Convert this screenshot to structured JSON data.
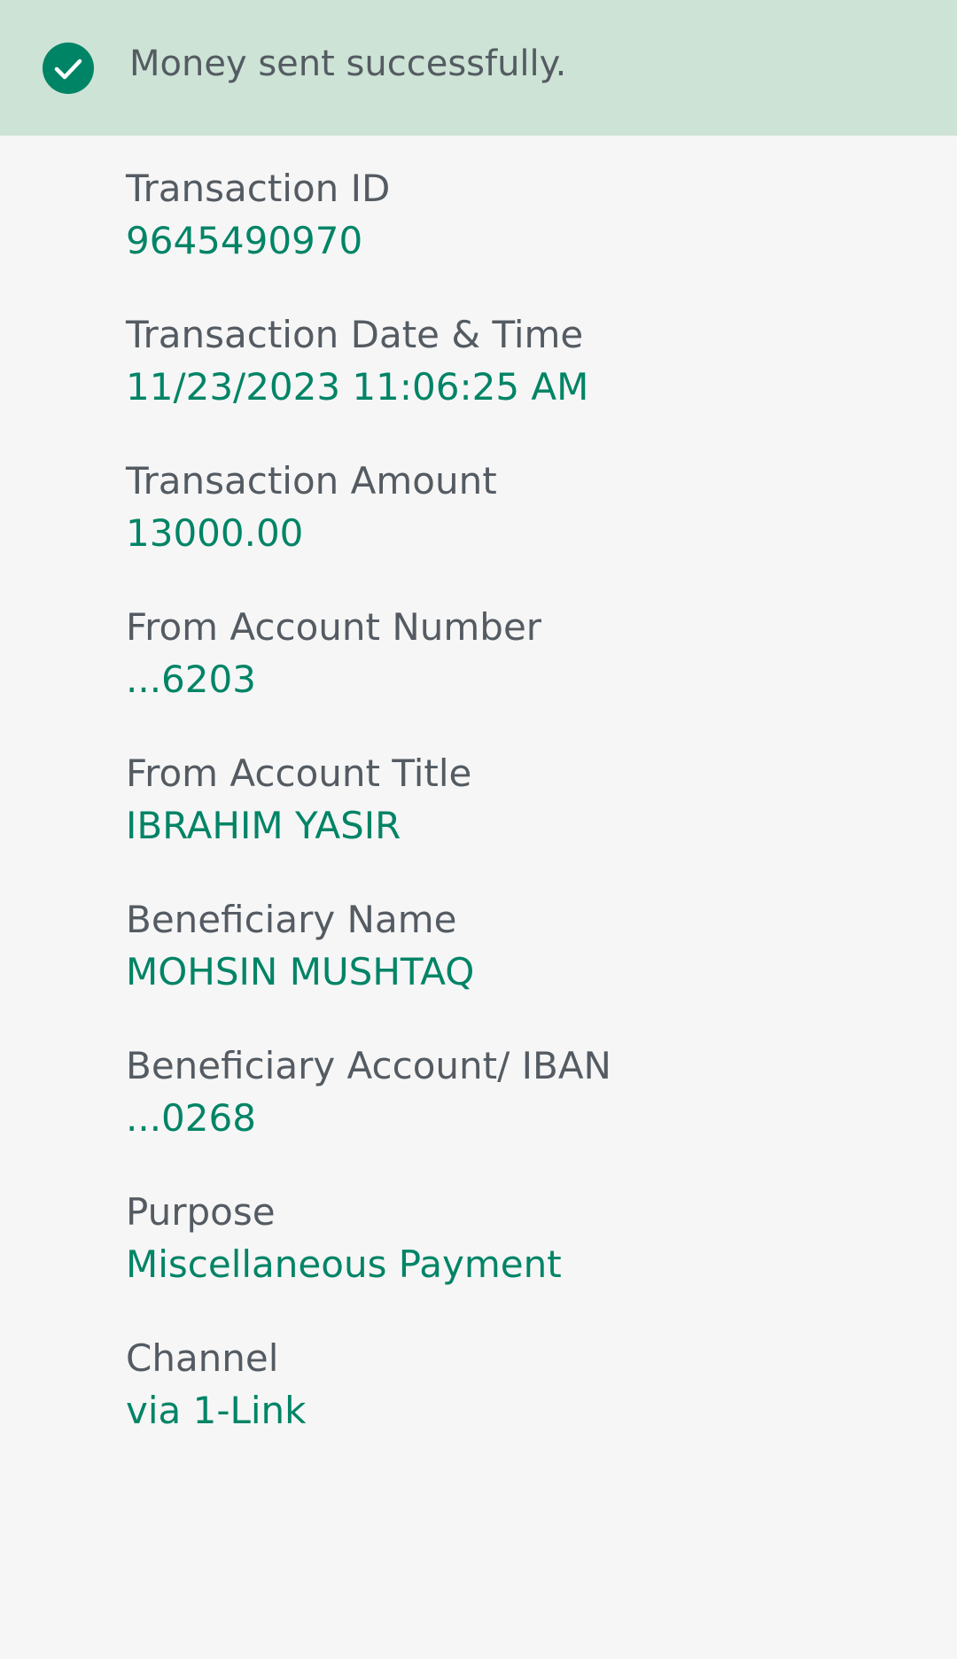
{
  "banner": {
    "icon": "check-circle-icon",
    "message": "Money sent successfully."
  },
  "details": [
    {
      "label": "Transaction ID",
      "value": "9645490970"
    },
    {
      "label": "Transaction Date & Time",
      "value": "11/23/2023 11:06:25 AM"
    },
    {
      "label": "Transaction Amount",
      "value": "13000.00"
    },
    {
      "label": "From Account Number",
      "value": "...6203"
    },
    {
      "label": "From Account Title",
      "value": "IBRAHIM YASIR"
    },
    {
      "label": "Beneficiary Name",
      "value": "MOHSIN MUSHTAQ"
    },
    {
      "label": "Beneficiary Account/ IBAN",
      "value": "...0268"
    },
    {
      "label": "Purpose",
      "value": "Miscellaneous Payment"
    },
    {
      "label": "Channel",
      "value": "via 1-Link"
    }
  ],
  "colors": {
    "banner_bg": "#cde3d5",
    "accent": "#008466",
    "label_text": "#545b62",
    "page_bg": "#f6f6f6"
  }
}
